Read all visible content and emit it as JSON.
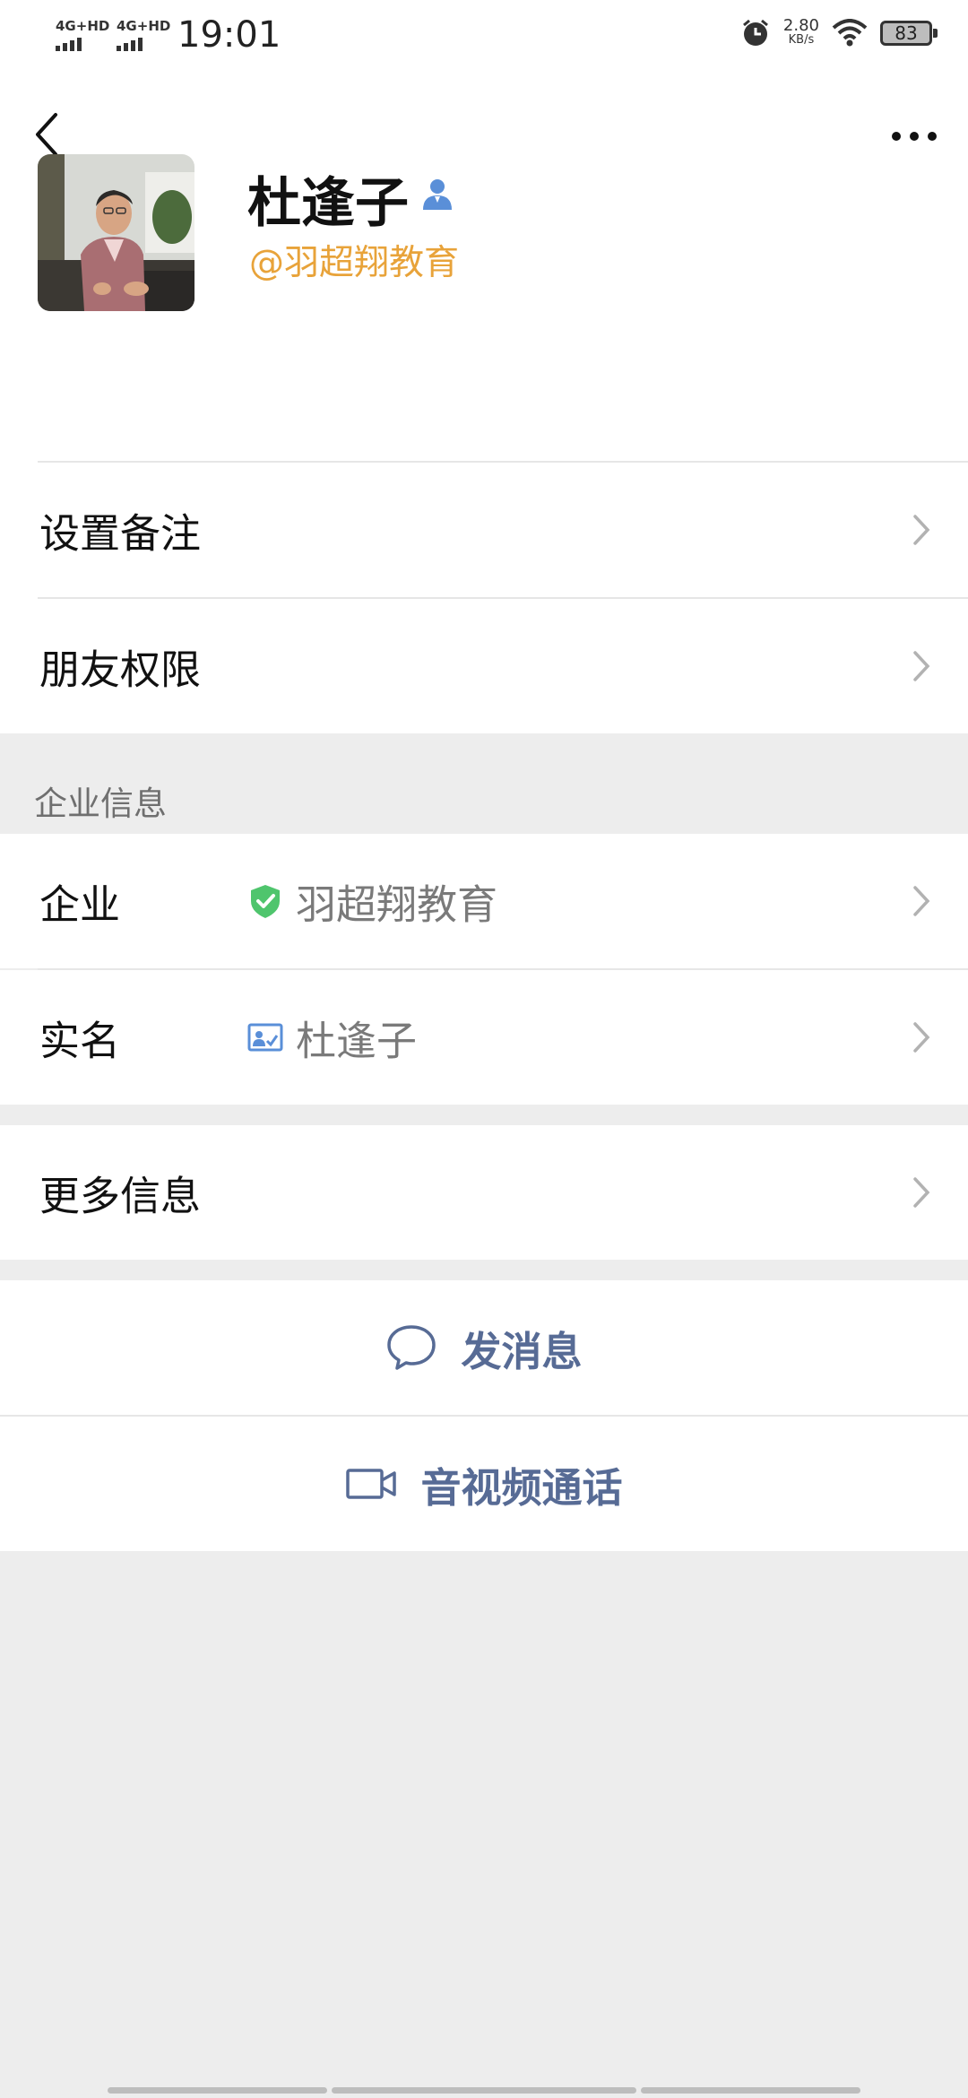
{
  "status_bar": {
    "network_1": "4G+HD",
    "network_2": "4G+HD",
    "time": "19:01",
    "speed_value": "2.80",
    "speed_unit": "KB/s",
    "battery": "83"
  },
  "profile": {
    "name": "杜逢子",
    "company_tag": "@羽超翔教育",
    "avatar_icon": "profile-photo"
  },
  "rows": {
    "remark": {
      "label": "设置备注"
    },
    "permissions": {
      "label": "朋友权限"
    },
    "enterprise": {
      "label": "企业",
      "value": "羽超翔教育"
    },
    "real_name": {
      "label": "实名",
      "value": "杜逢子"
    },
    "more_info": {
      "label": "更多信息"
    }
  },
  "section": {
    "enterprise_info": "企业信息"
  },
  "actions": {
    "message": "发消息",
    "call": "音视频通话"
  },
  "colors": {
    "accent_link": "#576b95",
    "company_tag": "#e8a33a",
    "verified_green": "#4fc56d",
    "icon_blue": "#5a8fd8"
  }
}
